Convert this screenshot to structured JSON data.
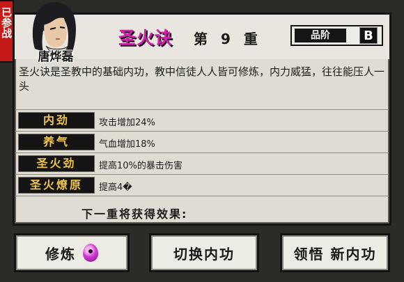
{
  "side_badge": {
    "text": "已参战"
  },
  "character": {
    "name": "唐烨磊"
  },
  "skill": {
    "title": "圣火诀",
    "level_prefix": "第",
    "level_number": "9",
    "level_suffix": "重",
    "grade_label": "品阶",
    "grade_value": "B",
    "description": "圣火诀是圣教中的基础内功，教中信徒人人皆可修炼，内力威猛，往往能压人一头"
  },
  "stats": [
    {
      "label": "内劲",
      "value": "攻击增加24%"
    },
    {
      "label": "养气",
      "value": "气血增加18%"
    },
    {
      "label": "圣火劲",
      "value": "提高10%的暴击伤害"
    },
    {
      "label": "圣火燎原",
      "value": "提高4�"
    }
  ],
  "next_effect": "下一重将获得效果:",
  "buttons": {
    "cultivate": "修炼",
    "switch": "切换内功",
    "learn": "领悟 新内功"
  },
  "colors": {
    "skill_title": "#d61fb0",
    "stat_label_text": "#f1c54a",
    "badge": "#c61a1a",
    "panel": "#dedcd3"
  }
}
